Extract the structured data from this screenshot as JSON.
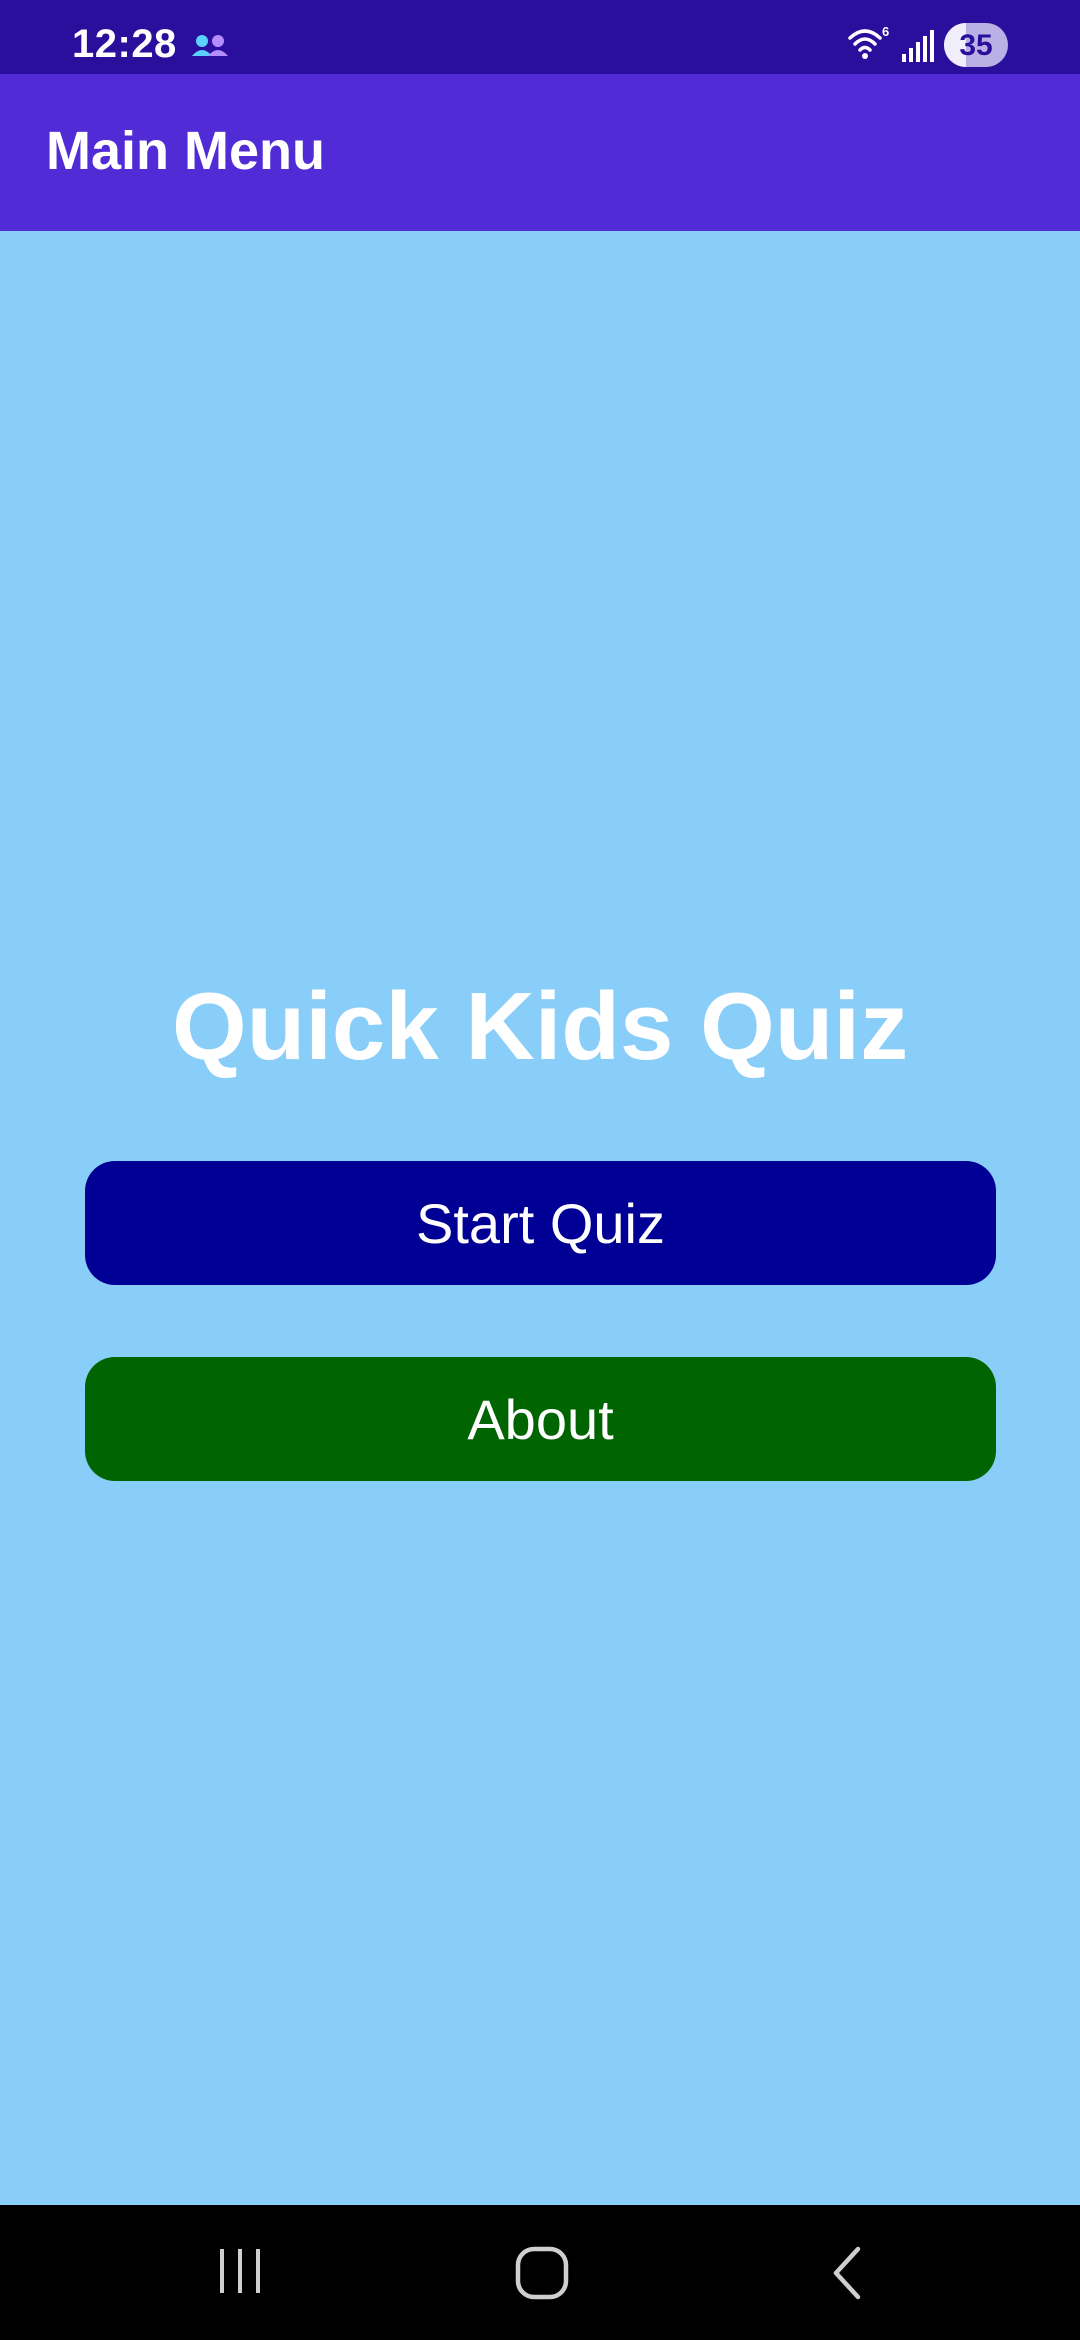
{
  "status_bar": {
    "time": "12:28",
    "battery_level": "35",
    "wifi_label": "6",
    "icons": [
      "notification-icon",
      "wifi-icon",
      "signal-icon",
      "battery-icon"
    ]
  },
  "app_bar": {
    "title": "Main Menu"
  },
  "main": {
    "heading": "Quick Kids Quiz",
    "start_button_label": "Start Quiz",
    "about_button_label": "About"
  },
  "nav_bar": {
    "icons": [
      "recents-icon",
      "home-icon",
      "back-icon"
    ]
  },
  "colors": {
    "status_bar": "#2a0f9c",
    "app_bar": "#512bd6",
    "background": "#89cdf9",
    "start_button": "#000094",
    "about_button": "#006400",
    "nav_bar": "#000000"
  }
}
